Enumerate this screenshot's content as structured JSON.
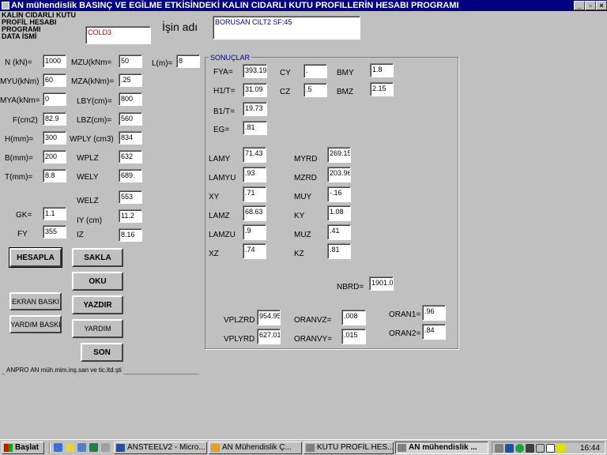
{
  "window": {
    "title": "AN mühendislik BASINÇ VE EGİLME  ETKİSİNDEKİ  KALIN CIDARLI KUTU PROFILLERİN  HESABI  PROGRAMI"
  },
  "header": {
    "program_label_lines": [
      "KALIN  CIDARLI KUTU",
      "PROFİL   HESABI",
      "PROGRAMI",
      "DATA  İSMİ"
    ],
    "data_name_value": "COLD3",
    "job_name_label": "İşin adı",
    "job_name_value": "BORUSAN CILT2  SF:45"
  },
  "inputs_col1": [
    {
      "label": "N (kN)=",
      "value": "1000"
    },
    {
      "label": "MYU(kNm)",
      "value": "60"
    },
    {
      "label": "MYA(kNm=",
      "value": "0"
    },
    {
      "label": "F(cm2)",
      "value": "82.9"
    },
    {
      "label": "H(mm)=",
      "value": "300"
    },
    {
      "label": "B(mm)=",
      "value": "200"
    },
    {
      "label": "T(mm)=",
      "value": "8.8"
    },
    {
      "label": "GK=",
      "value": "1.1"
    },
    {
      "label": "FY",
      "value": "355"
    }
  ],
  "inputs_col2": [
    {
      "label": "MZU(kNm=",
      "value": "50"
    },
    {
      "label": "MZA(kNm)=",
      "value": ".25"
    },
    {
      "label": "LBY(cm)=",
      "value": "800"
    },
    {
      "label": "LBZ(cm)=",
      "value": "560"
    },
    {
      "label": "WPLY (cm3)",
      "value": "834"
    },
    {
      "label": "WPLZ",
      "value": "632"
    },
    {
      "label": "WELY",
      "value": "689."
    },
    {
      "label": "WELZ",
      "value": "553"
    },
    {
      "label": "IY (cm)",
      "value": "11.2"
    },
    {
      "label": "IZ",
      "value": "8.16"
    }
  ],
  "length": {
    "label": "L(m)=",
    "value": "8"
  },
  "buttons": {
    "hesapla": "HESAPLA",
    "sakla": "SAKLA",
    "oku": "OKU",
    "ekran_baski": "EKRAN BASKI",
    "yazdir": "YAZDIR",
    "yardim_baski": "YARDIM BASKI",
    "yardim": "YARDIM",
    "son": "SON"
  },
  "footer": {
    "text": "ANPRO    AN müh.mim.inş.san ve tic.ltd.şti"
  },
  "results": {
    "title": "SONUÇLAR",
    "fya": {
      "label": "FYA=",
      "value": "393.19"
    },
    "h1t": {
      "label": "H1/T=",
      "value": "31.09"
    },
    "b1t": {
      "label": "B1/T=",
      "value": "19.73"
    },
    "eg": {
      "label": "EG=",
      "value": ".81"
    },
    "cy": {
      "label": "CY",
      "value": "."
    },
    "cz": {
      "label": "CZ",
      "value": ".5"
    },
    "bmy": {
      "label": "BMY",
      "value": "1.8"
    },
    "bmz": {
      "label": "BMZ",
      "value": "2.15"
    },
    "lamy": {
      "label": "LAMY",
      "value": "71.43"
    },
    "lamyu": {
      "label": "LAMYU",
      "value": ".93"
    },
    "xy": {
      "label": "XY",
      "value": ".71"
    },
    "lamz": {
      "label": "LAMZ",
      "value": "68.63"
    },
    "lamzu": {
      "label": "LAMZU",
      "value": ".9"
    },
    "xz": {
      "label": "XZ",
      "value": ".74"
    },
    "myrd": {
      "label": "MYRD",
      "value": "269.15"
    },
    "mzrd": {
      "label": "MZRD",
      "value": "203.96"
    },
    "muy": {
      "label": "MUY",
      "value": "-.16"
    },
    "ky": {
      "label": "KY",
      "value": "1.08"
    },
    "muz": {
      "label": "MUZ",
      "value": ".41"
    },
    "kz": {
      "label": "KZ",
      "value": ".81"
    },
    "nbrd": {
      "label": "NBRD=",
      "value": "1901.0"
    },
    "vplzrd": {
      "label": "VPLZRD",
      "value": "954.95"
    },
    "vplyrd": {
      "label": "VPLYRD",
      "value": "627.01"
    },
    "oranvz": {
      "label": "ORANVZ=",
      "value": ".008"
    },
    "oranvy": {
      "label": "ORANVY=",
      "value": ".015"
    },
    "oran1": {
      "label": "ORAN1=",
      "value": ".96"
    },
    "oran2": {
      "label": "ORAN2=",
      "value": ".84"
    }
  },
  "taskbar": {
    "start": "Başlat",
    "items": [
      "ANSTEELV2 - Micro...",
      "AN Mühendislik     Ç...",
      "KUTU PROFİL HES...",
      "AN mühendislik  ..."
    ],
    "clock": "16:44"
  }
}
